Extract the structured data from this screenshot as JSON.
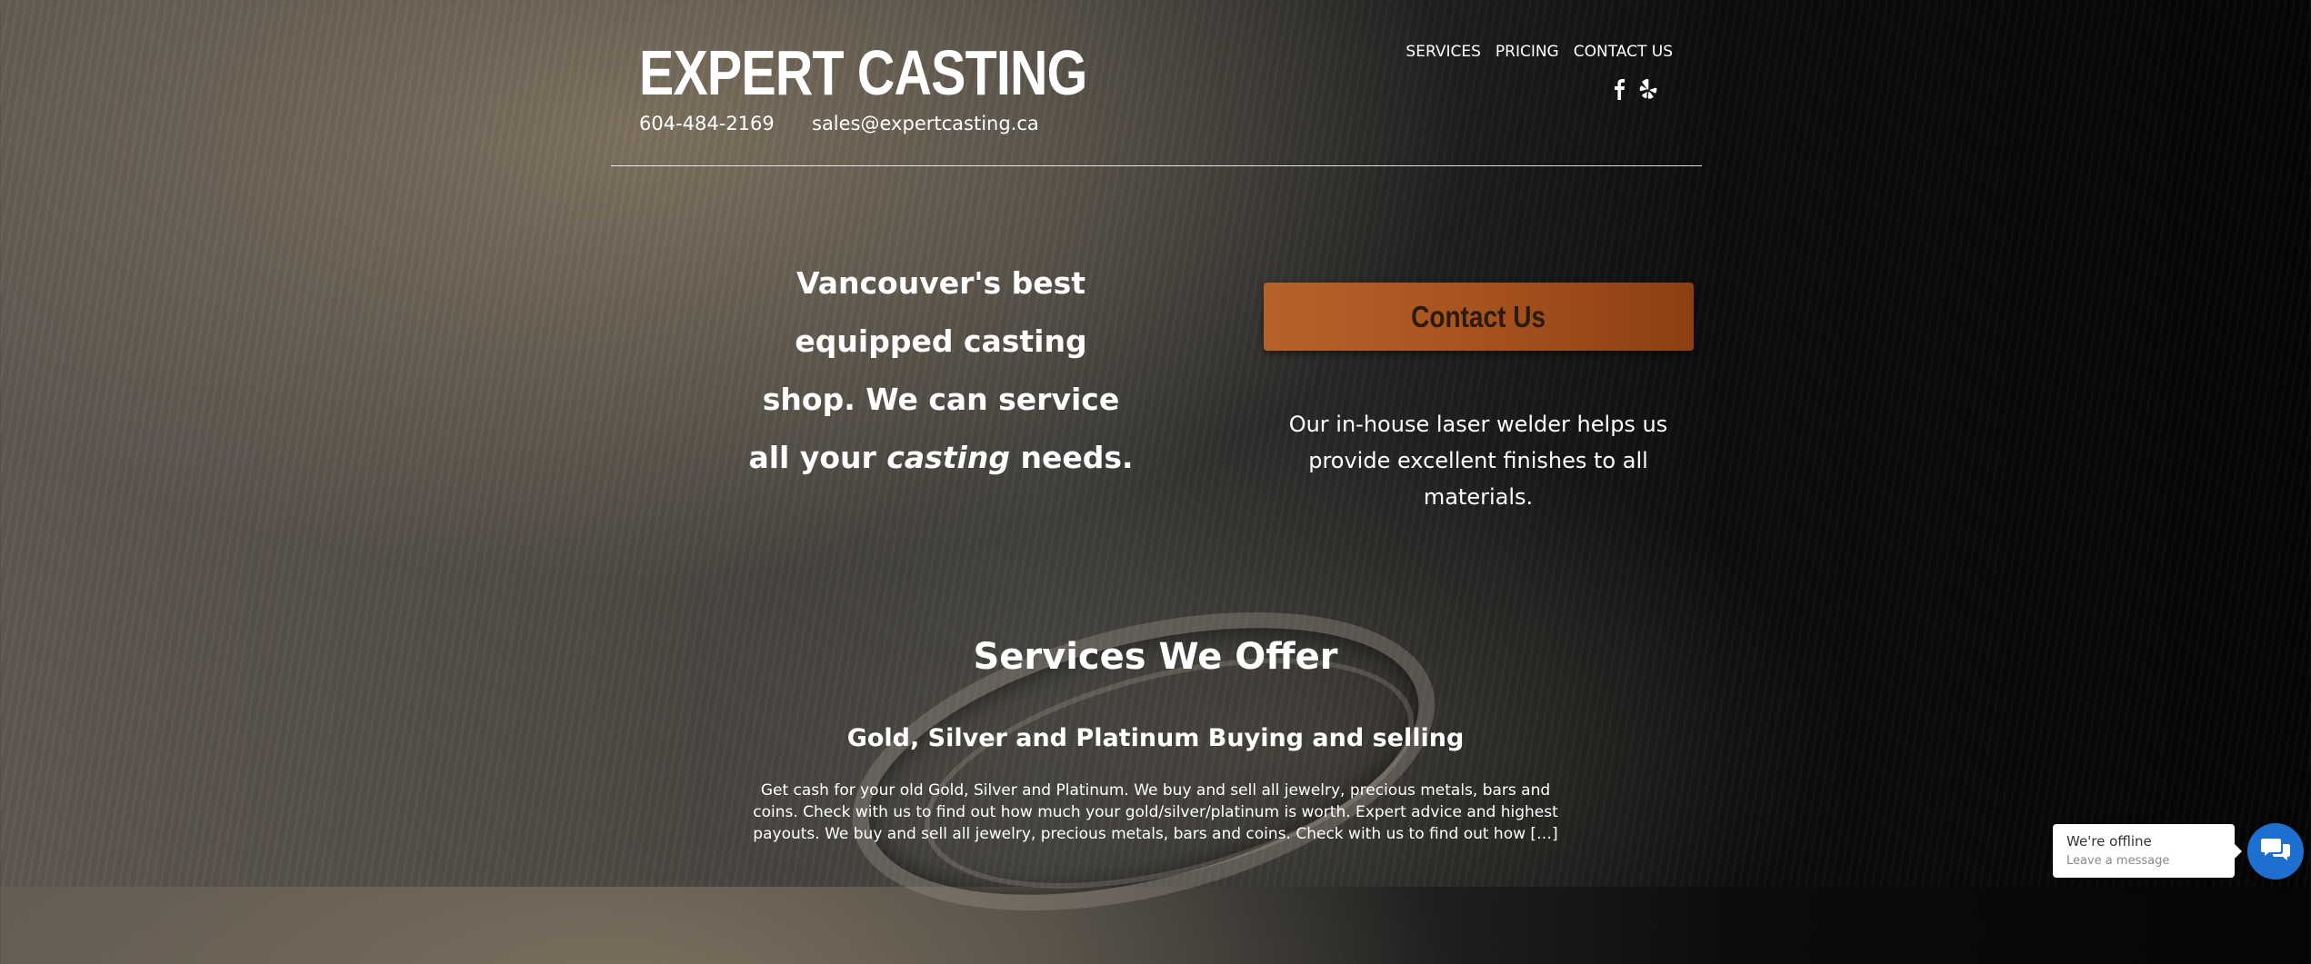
{
  "header": {
    "logo": "EXPERT CASTING",
    "phone": "604-484-2169",
    "email": "sales@expertcasting.ca",
    "nav": [
      {
        "label": "SERVICES"
      },
      {
        "label": "PRICING"
      },
      {
        "label": "CONTACT US"
      }
    ],
    "social": [
      "facebook-icon",
      "yelp-icon"
    ]
  },
  "hero": {
    "tagline_before": "Vancouver's best equipped casting shop. We can service all your ",
    "tagline_emphasis": "casting",
    "tagline_after": " needs.",
    "cta_label": "Contact Us",
    "laser_text": "Our in-house laser welder helps us provide excellent finishes to all materials."
  },
  "services": {
    "title": "Services We Offer",
    "subtitle": "Gold, Silver and Platinum Buying and selling",
    "description": "Get cash for your old Gold, Silver and Platinum. We buy and sell all jewelry, precious metals, bars and coins. Check with us to find out how much your gold/silver/platinum is worth. Expert advice and highest payouts. We buy and sell all jewelry, precious metals, bars and coins. Check with us to find out how […]"
  },
  "chat": {
    "status": "We're offline",
    "prompt": "Leave a message"
  },
  "colors": {
    "cta": "#a7531f",
    "chat_button": "#1f6fd1"
  }
}
